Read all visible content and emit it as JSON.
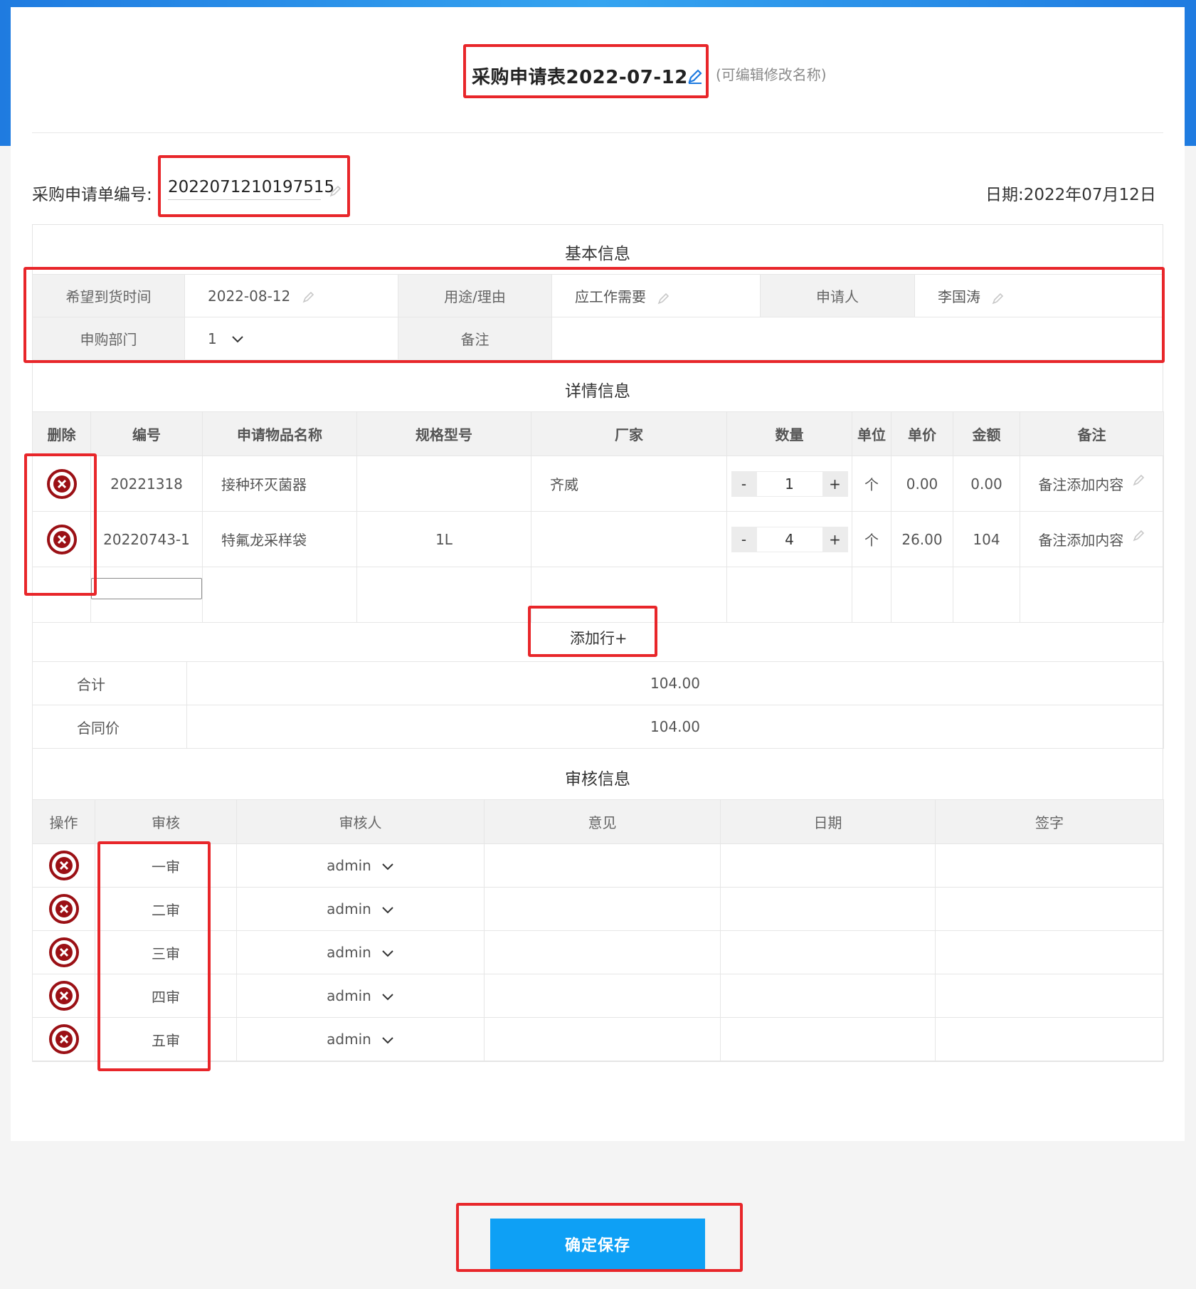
{
  "form": {
    "title": "采购申请表2022-07-12",
    "title_hint": "(可编辑修改名称)",
    "number_label": "采购申请单编号:",
    "number_value": "2022071210197515",
    "date_label": "日期:2022年07月12日"
  },
  "basic": {
    "section_title": "基本信息",
    "arrival_label": "希望到货时间",
    "arrival_value": "2022-08-12",
    "purpose_label": "用途/理由",
    "purpose_value": "应工作需要",
    "applicant_label": "申请人",
    "applicant_value": "李国涛",
    "dept_label": "申购部门",
    "dept_value": "1",
    "remark_label": "备注",
    "remark_value": ""
  },
  "detail": {
    "section_title": "详情信息",
    "headers": [
      "删除",
      "编号",
      "申请物品名称",
      "规格型号",
      "厂家",
      "数量",
      "单位",
      "单价",
      "金额",
      "备注"
    ],
    "rows": [
      {
        "code": "20221318",
        "name": "接种环灭菌器",
        "spec": "",
        "maker": "齐威",
        "qty": "1",
        "unit": "个",
        "price": "0.00",
        "amount": "0.00",
        "note": "备注添加内容"
      },
      {
        "code": "20220743-1",
        "name": "特氟龙采样袋",
        "spec": "1L",
        "maker": "",
        "qty": "4",
        "unit": "个",
        "price": "26.00",
        "amount": "104",
        "note": "备注添加内容"
      }
    ],
    "minus": "-",
    "plus": "+",
    "add_row": "添加行+"
  },
  "summary": {
    "total_label": "合计",
    "total_value": "104.00",
    "contract_label": "合同价",
    "contract_value": "104.00"
  },
  "audit": {
    "section_title": "审核信息",
    "headers": [
      "操作",
      "审核",
      "审核人",
      "意见",
      "日期",
      "签字"
    ],
    "rows": [
      {
        "level": "一审",
        "reviewer": "admin"
      },
      {
        "level": "二审",
        "reviewer": "admin"
      },
      {
        "level": "三审",
        "reviewer": "admin"
      },
      {
        "level": "四审",
        "reviewer": "admin"
      },
      {
        "level": "五审",
        "reviewer": "admin"
      }
    ]
  },
  "actions": {
    "save_label": "确定保存"
  },
  "colors": {
    "accent": "#0ea0f5",
    "highlight_box": "#e8262a",
    "delete_icon": "#9b1015"
  }
}
